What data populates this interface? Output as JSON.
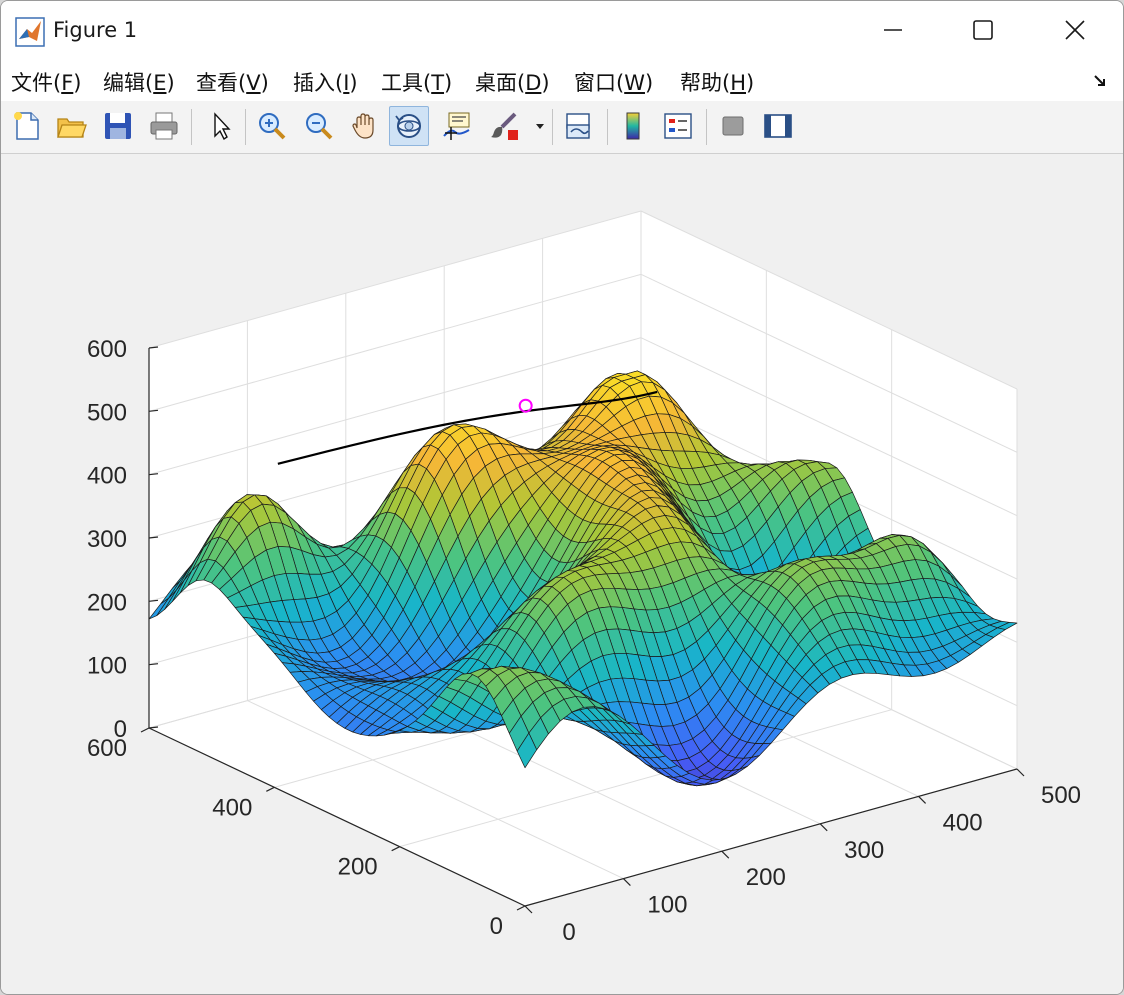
{
  "window": {
    "title": "Figure 1",
    "controls": {
      "minimize": "minimize",
      "maximize": "maximize",
      "close": "close"
    }
  },
  "menu": {
    "items": [
      {
        "label": "文件(F)",
        "key": "F"
      },
      {
        "label": "编辑(E)",
        "key": "E"
      },
      {
        "label": "查看(V)",
        "key": "V"
      },
      {
        "label": "插入(I)",
        "key": "I"
      },
      {
        "label": "工具(T)",
        "key": "T"
      },
      {
        "label": "桌面(D)",
        "key": "D"
      },
      {
        "label": "窗口(W)",
        "key": "W"
      },
      {
        "label": "帮助(H)",
        "key": "H"
      }
    ]
  },
  "toolbar": {
    "buttons": [
      "new-figure-icon",
      "open-file-icon",
      "save-icon",
      "print-icon",
      "select-arrow-icon",
      "zoom-in-icon",
      "zoom-out-icon",
      "pan-hand-icon",
      "rotate-3d-icon",
      "data-cursor-icon",
      "brush-icon",
      "link-plot-icon",
      "colorbar-icon",
      "legend-icon",
      "hide-plot-tools-icon",
      "show-plot-tools-icon"
    ],
    "active": "rotate-3d-icon"
  },
  "chart_data": {
    "type": "surface",
    "colormap": "parula",
    "grid": true,
    "x_axis": {
      "ticks": [
        "0",
        "100",
        "200",
        "300",
        "400",
        "500"
      ],
      "lim": [
        0,
        500
      ]
    },
    "y_axis": {
      "ticks": [
        "0",
        "200",
        "400",
        "600"
      ],
      "lim": [
        0,
        600
      ]
    },
    "z_axis": {
      "ticks": [
        "0",
        "100",
        "200",
        "300",
        "400",
        "500",
        "600"
      ],
      "lim": [
        0,
        600
      ]
    },
    "surface_z_range": [
      40,
      470
    ],
    "overlays": [
      "black path curve over peaks",
      "magenta start marker near central peak"
    ]
  },
  "colors": {
    "surface_low": "#3e26a8",
    "surface_mid": "#21b7a2",
    "surface_high": "#f9c936",
    "path": "#000000",
    "marker": "#ff00ff"
  }
}
